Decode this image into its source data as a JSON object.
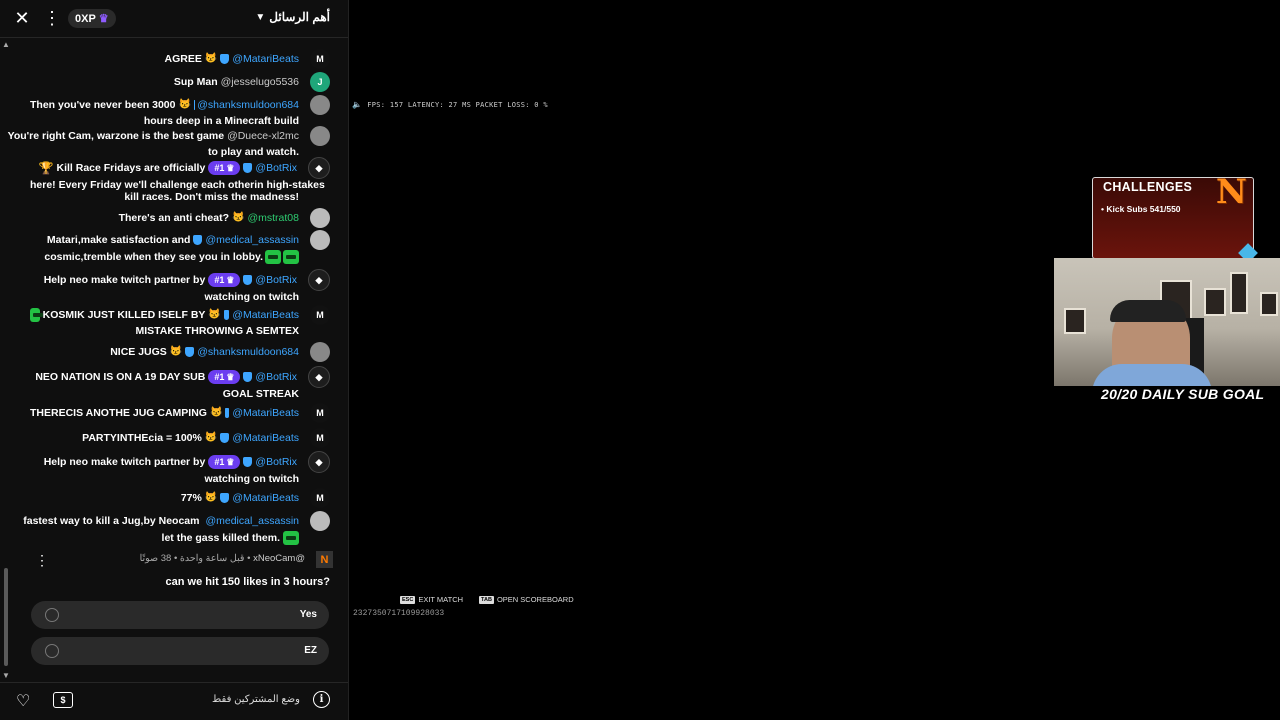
{
  "header": {
    "close_icon": "close-icon",
    "kebab_icon": "more-vert-icon",
    "xp_label": "0XP",
    "top_messages_label": "أهم الرسائل"
  },
  "messages": [
    {
      "text": "AGREE",
      "user": "@MatariBeats",
      "avatar": "M",
      "badges": [
        "mod",
        "verified"
      ],
      "user_color": "blue"
    },
    {
      "text": "Sup Man",
      "user": "@jesselugo5536",
      "avatar": "J",
      "badges": [],
      "user_color": "gray"
    },
    {
      "text": "Then you've never been 3000",
      "text2": "hours deep in a Minecraft build",
      "user": "@shanksmuldoon684",
      "badges": [
        "mod",
        "verified"
      ],
      "user_color": "blue"
    },
    {
      "text": "You're right Cam, warzone is the best game",
      "text2": "to play and watch.",
      "user": "@Duece-xl2mc",
      "badges": [],
      "user_color": "gray"
    },
    {
      "text": "Kill Race Fridays are officially",
      "text2": "here! Every Friday we'll challenge each otherin high-stakes",
      "text3": "kill races. Don't miss the madness!",
      "rank": "#1",
      "user": "@BotRix",
      "badges": [
        "verified"
      ],
      "user_color": "blue"
    },
    {
      "text": "There's an anti cheat?",
      "user": "@mstrat08",
      "badges": [
        "mod"
      ],
      "user_color": "green"
    },
    {
      "text": "Matari,make satisfaction and",
      "text2": "cosmic,tremble when they see you in lobby.",
      "user": "@medical_assassin",
      "badges": [
        "verified"
      ],
      "user_color": "blue"
    },
    {
      "text": "Help neo make twitch partner by",
      "text2": "watching on twitch",
      "rank": "#1",
      "user": "@BotRix",
      "badges": [
        "verified"
      ],
      "user_color": "blue"
    },
    {
      "text": "KOSMIK JUST KILLED ISELF BY",
      "text2": "MISTAKE THROWING A SEMTEX",
      "user": "@MatariBeats",
      "badges": [
        "mod",
        "verified"
      ],
      "user_color": "blue"
    },
    {
      "text": "NICE JUGS",
      "user": "@shanksmuldoon684",
      "badges": [
        "mod",
        "verified"
      ],
      "user_color": "blue"
    },
    {
      "text": "NEO NATION IS ON A 19 DAY SUB",
      "text2": "GOAL STREAK",
      "rank": "#1",
      "user": "@BotRix",
      "badges": [
        "verified"
      ],
      "user_color": "blue"
    },
    {
      "text": "THERECIS ANOTHE JUG CAMPING",
      "user": "@MatariBeats",
      "badges": [
        "mod",
        "verified"
      ],
      "user_color": "blue"
    },
    {
      "text": "PARTYINTHEcia = 100%",
      "user": "@MatariBeats",
      "badges": [
        "mod",
        "verified"
      ],
      "user_color": "blue"
    },
    {
      "text": "Help neo make twitch partner by",
      "text2": "watching on twitch",
      "rank": "#1",
      "user": "@BotRix",
      "badges": [
        "verified"
      ],
      "user_color": "blue"
    },
    {
      "text": "77%",
      "user": "@MatariBeats",
      "badges": [
        "mod",
        "verified"
      ],
      "user_color": "blue"
    },
    {
      "text": "fastest way to kill a Jug,by Neocam",
      "text2": "let the gass killed them.",
      "user": "@medical_assassin",
      "badges": [
        "verified"
      ],
      "user_color": "blue"
    }
  ],
  "poll": {
    "user": "@xNeoCam",
    "meta": "قبل ساعة واحدة • 38 صوتًا",
    "question": "can we hit 150 likes in 3 hours?",
    "options": [
      {
        "label": "Yes"
      },
      {
        "label": "EZ"
      }
    ]
  },
  "footer": {
    "subs_only": "وضع المشتركين فقط",
    "heart_icon": "heart-icon",
    "dollar_icon": "super-chat-icon",
    "info_icon": "info-icon"
  },
  "overlay": {
    "perf": "FPS: 157  LATENCY: 27 MS  PACKET LOSS: 0 %",
    "exit_key": "ESC",
    "exit_label": "EXIT MATCH",
    "scoreboard_key": "TAB",
    "scoreboard_label": "OPEN SCOREBOARD",
    "game_id": "2327350717109928033",
    "challenges_title": "CHALLENGES",
    "challenges_item": "• Kick Subs 541/550",
    "challenges_logo": "N",
    "sub_goal": "20/20 DAILY SUB GOAL"
  },
  "colors": {
    "username_blue": "#3ea6ff",
    "rank_purple": "#6b3df0",
    "chat_bg": "#0f0f0f",
    "challenge_red": "#6b140c"
  }
}
